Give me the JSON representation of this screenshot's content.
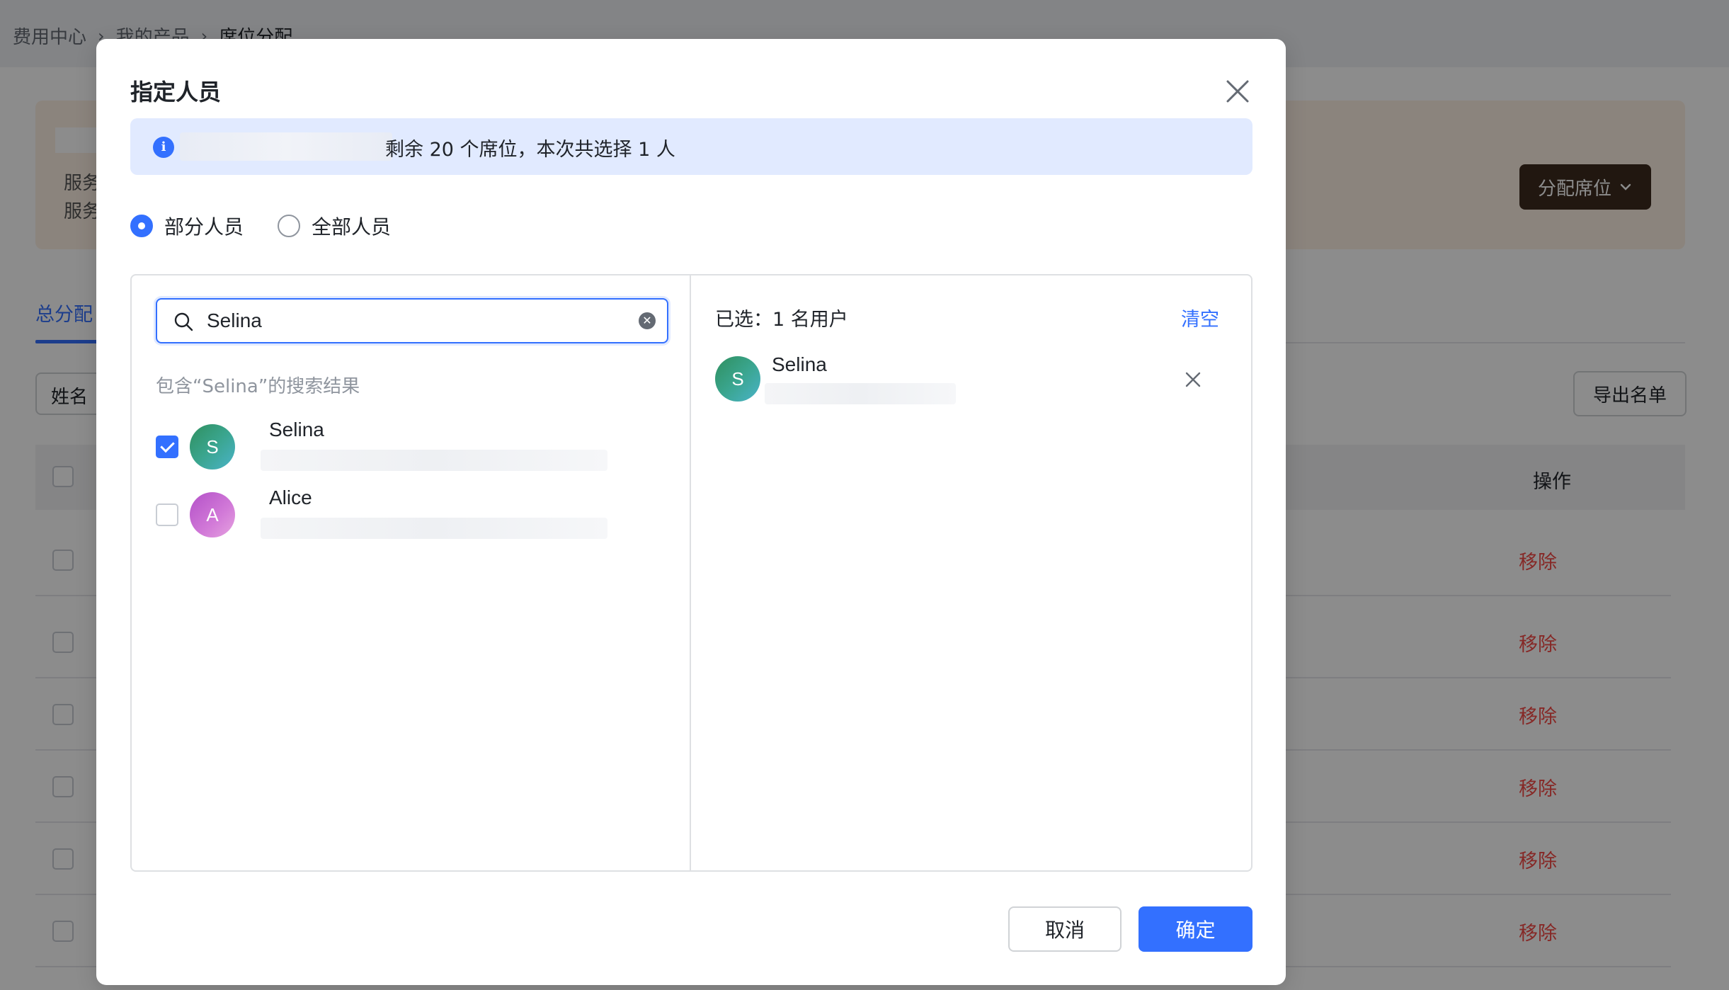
{
  "breadcrumb": {
    "items": [
      "费用中心",
      "我的产品",
      "席位分配"
    ]
  },
  "service_card": {
    "line1": "服务",
    "line2": "服务",
    "assign_button": "分配席位"
  },
  "tabs": {
    "total": "总分配"
  },
  "filters": {
    "name_placeholder": "姓名",
    "export_button": "导出名单"
  },
  "table": {
    "header_action": "操作",
    "rows": [
      {
        "action": "移除"
      },
      {
        "action": "移除"
      },
      {
        "action": "移除"
      },
      {
        "action": "移除"
      },
      {
        "action": "移除"
      },
      {
        "action": "移除"
      }
    ]
  },
  "modal": {
    "title": "指定人员",
    "info_text": "剩余 20 个席位，本次共选择 1 人",
    "radios": [
      {
        "label": "部分人员",
        "checked": true
      },
      {
        "label": "全部人员",
        "checked": false
      }
    ],
    "search": {
      "value": "Selina"
    },
    "result_hint": "包含“Selina”的搜索结果",
    "results": [
      {
        "name": "Selina",
        "initial": "S",
        "checked": true
      },
      {
        "name": "Alice",
        "initial": "A",
        "checked": false
      }
    ],
    "selected": {
      "count_text": "已选：1 名用户",
      "clear_label": "清空",
      "items": [
        {
          "name": "Selina",
          "initial": "S"
        }
      ]
    },
    "cancel_label": "取消",
    "confirm_label": "确定"
  },
  "colors": {
    "primary": "#3370ff",
    "danger": "#f54a45",
    "info_bg": "#e1eaff",
    "assign_button_bg": "#3d2a1e"
  }
}
